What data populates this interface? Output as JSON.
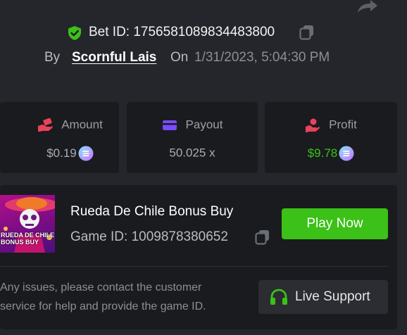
{
  "bet": {
    "id_text": "Bet ID: 1756581089834483800",
    "by_label": "By",
    "username": "Scornful Lais",
    "on_label": "On",
    "date": "1/31/2023, 5:04:30 PM"
  },
  "stats": {
    "amount": {
      "label": "Amount",
      "value": "$0.19",
      "icon": "money-hand-icon",
      "currency_icon": "solana-coin-icon"
    },
    "payout": {
      "label": "Payout",
      "value": "50.025 x",
      "icon": "card-icon"
    },
    "profit": {
      "label": "Profit",
      "value": "$9.78",
      "icon": "profit-hand-icon",
      "currency_icon": "solana-coin-icon"
    }
  },
  "game": {
    "title": "Rueda De Chile Bonus Buy",
    "id_text": "Game ID: 1009878380652",
    "thumbnail_text_line1": "RUEDA DE CHILE",
    "thumbnail_text_line2": "BONUS BUY",
    "play_label": "Play Now",
    "help_text": "Any issues, please contact the customer service for help and provide the game ID.",
    "support_label": "Live Support"
  },
  "colors": {
    "background": "#24262b",
    "card": "#1a1b1f",
    "accent_green": "#3bc117",
    "profit_green": "#3bc117",
    "amount_icon": "#e8435a",
    "payout_icon": "#7b4bff",
    "profit_icon": "#e8435a"
  }
}
